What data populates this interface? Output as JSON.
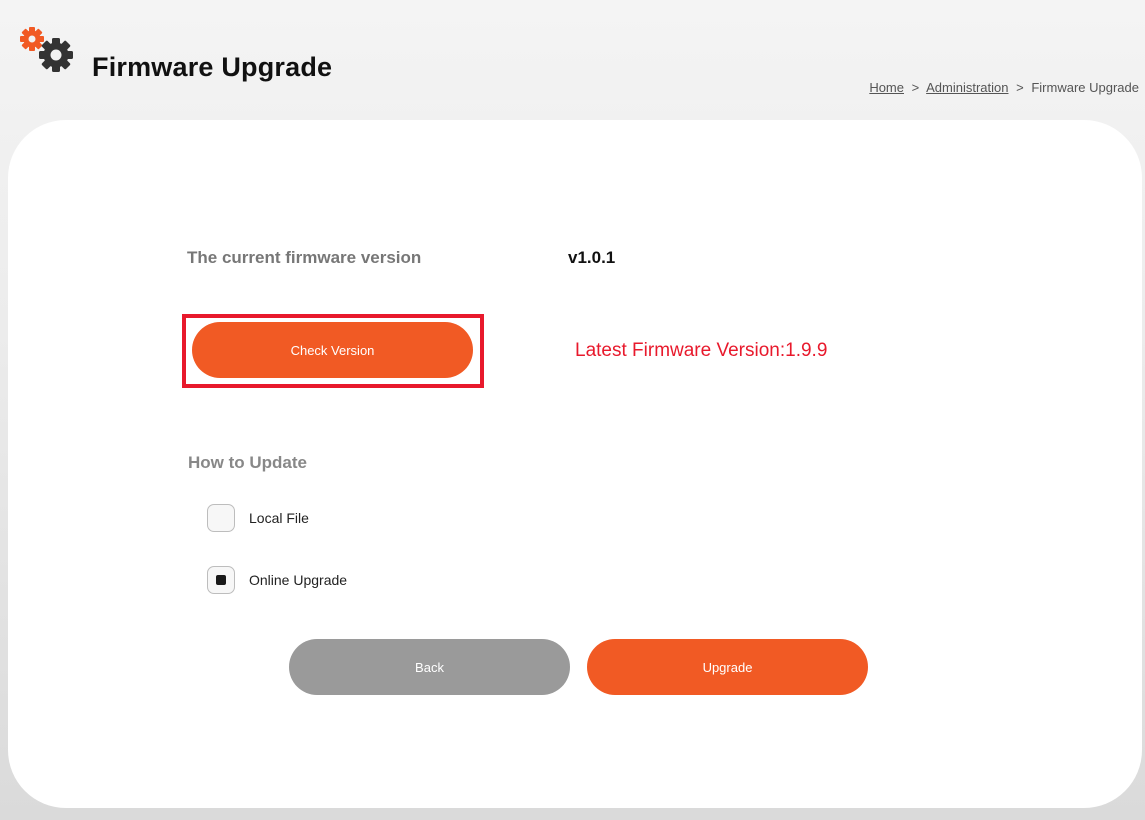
{
  "header": {
    "title": "Firmware Upgrade",
    "breadcrumb": {
      "home": "Home",
      "sep1": ">",
      "admin": "Administration",
      "sep2": ">",
      "current": "Firmware Upgrade"
    }
  },
  "firmware": {
    "label": "The current firmware version",
    "value": "v1.0.1",
    "check_button_label": "Check Version",
    "latest_text": "Latest Firmware Version:1.9.9"
  },
  "update": {
    "heading": "How to Update",
    "options": [
      {
        "label": "Local File",
        "selected": false
      },
      {
        "label": "Online Upgrade",
        "selected": true
      }
    ]
  },
  "actions": {
    "back_label": "Back",
    "upgrade_label": "Upgrade"
  },
  "colors": {
    "accent": "#f15a24",
    "alert": "#e8192c",
    "secondary_button": "#9a9a9a",
    "gear_small": "#f15a24",
    "gear_large": "#333333"
  },
  "icons": {
    "header": "gears-icon"
  }
}
